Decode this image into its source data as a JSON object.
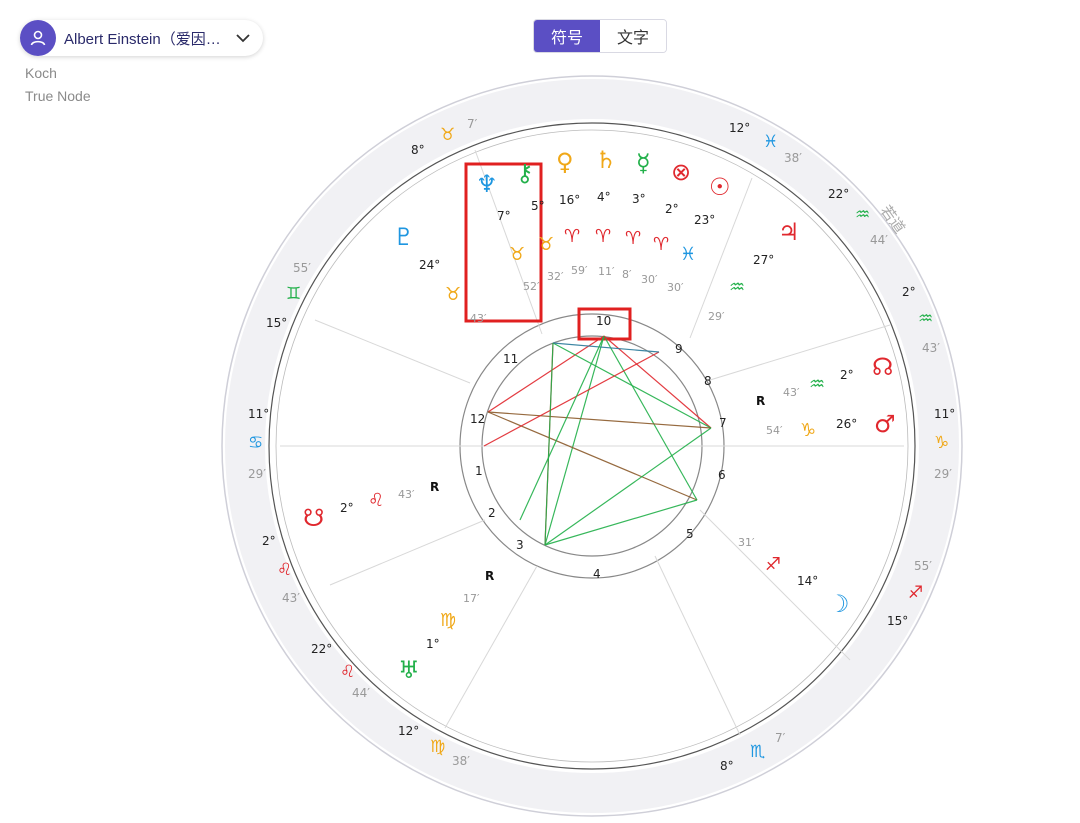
{
  "person": {
    "name": "Albert Einstein（爱因…",
    "avatar_icon": "user-icon",
    "chevron_icon": "chevron-down-icon"
  },
  "house_system": "Koch",
  "node_type": "True Node",
  "view_toggle": {
    "symbol_label": "符号",
    "text_label": "文字",
    "active": "symbol"
  },
  "colors": {
    "accent": "#5b4fc4",
    "fire": "#e0282e",
    "earth": "#f0a818",
    "air": "#22b04a",
    "water": "#1e96e0",
    "highlight": "#e02020"
  },
  "outer_wheel_label": "若道",
  "house_cusps": [
    {
      "id": "asc-left",
      "deg": "11°",
      "sign": "♋",
      "color": "#1e96e0",
      "min": "29′"
    },
    {
      "id": "h2",
      "deg": "2°",
      "sign": "♌",
      "color": "#e0282e",
      "min": "43′"
    },
    {
      "id": "h3",
      "deg": "22°",
      "sign": "♌",
      "color": "#e0282e",
      "min": "44′"
    },
    {
      "id": "h4",
      "deg": "12°",
      "sign": "♍",
      "color": "#f0a818",
      "min": "38′"
    },
    {
      "id": "h5",
      "deg": "8°",
      "sign": "♏",
      "color": "#1e96e0",
      "min": "7′"
    },
    {
      "id": "h6",
      "deg": "15°",
      "sign": "♐",
      "color": "#e0282e",
      "min": "55′"
    },
    {
      "id": "dsc",
      "deg": "11°",
      "sign": "♑",
      "color": "#f0a818",
      "min": "29′"
    },
    {
      "id": "h8",
      "deg": "2°",
      "sign": "♒",
      "color": "#22b04a",
      "min": "43′"
    },
    {
      "id": "h9",
      "deg": "22°",
      "sign": "♒",
      "color": "#22b04a",
      "min": "44′"
    },
    {
      "id": "mc",
      "deg": "12°",
      "sign": "♓",
      "color": "#1e96e0",
      "min": "38′"
    },
    {
      "id": "h11",
      "deg": "8°",
      "sign": "♉",
      "color": "#f0a818",
      "min": "7′"
    },
    {
      "id": "h12",
      "deg": "15°",
      "sign": "♊",
      "color": "#22b04a",
      "min": "55′"
    }
  ],
  "planets": [
    {
      "name": "neptune",
      "glyph": "♆",
      "color": "#1e96e0",
      "deg": "7°",
      "sign": "♉",
      "sign_color": "#f0a818",
      "min": "52′",
      "retro": ""
    },
    {
      "name": "chiron",
      "glyph": "⚷",
      "color": "#22b04a",
      "deg": "5°",
      "sign": "♉",
      "sign_color": "#f0a818",
      "min": "32′",
      "retro": ""
    },
    {
      "name": "venus",
      "glyph": "♀",
      "color": "#f0a818",
      "deg": "16°",
      "sign": "♈",
      "sign_color": "#e0282e",
      "min": "59′",
      "retro": ""
    },
    {
      "name": "saturn",
      "glyph": "♄",
      "color": "#f0a818",
      "deg": "4°",
      "sign": "♈",
      "sign_color": "#e0282e",
      "min": "11′",
      "retro": ""
    },
    {
      "name": "mercury",
      "glyph": "☿",
      "color": "#22b04a",
      "deg": "3°",
      "sign": "♈",
      "sign_color": "#e0282e",
      "min": "8′",
      "retro": ""
    },
    {
      "name": "part-of-fortune",
      "glyph": "⊗",
      "color": "#e0282e",
      "deg": "2°",
      "sign": "♈",
      "sign_color": "#e0282e",
      "min": "30′",
      "retro": ""
    },
    {
      "name": "sun",
      "glyph": "☉",
      "color": "#e0282e",
      "deg": "23°",
      "sign": "♓",
      "sign_color": "#1e96e0",
      "min": "30′",
      "retro": ""
    },
    {
      "name": "jupiter",
      "glyph": "♃",
      "color": "#e0282e",
      "deg": "27°",
      "sign": "♒",
      "sign_color": "#22b04a",
      "min": "29′",
      "retro": ""
    },
    {
      "name": "north-node",
      "glyph": "☊",
      "color": "#e0282e",
      "deg": "2°",
      "sign": "♒",
      "sign_color": "#22b04a",
      "min": "43′",
      "retro": "R"
    },
    {
      "name": "mars",
      "glyph": "♂",
      "color": "#e0282e",
      "deg": "26°",
      "sign": "♑",
      "sign_color": "#f0a818",
      "min": "54′",
      "retro": ""
    },
    {
      "name": "moon",
      "glyph": "☽",
      "color": "#1e96e0",
      "deg": "14°",
      "sign": "♐",
      "sign_color": "#e0282e",
      "min": "31′",
      "retro": ""
    },
    {
      "name": "uranus",
      "glyph": "♅",
      "color": "#22b04a",
      "deg": "1°",
      "sign": "♍",
      "sign_color": "#f0a818",
      "min": "17′",
      "retro": "R"
    },
    {
      "name": "south-node",
      "glyph": "☋",
      "color": "#e0282e",
      "deg": "2°",
      "sign": "♌",
      "sign_color": "#e0282e",
      "min": "43′",
      "retro": "R"
    },
    {
      "name": "pluto",
      "glyph": "♇",
      "color": "#1e96e0",
      "deg": "24°",
      "sign": "♉",
      "sign_color": "#f0a818",
      "min": "43′",
      "retro": ""
    }
  ],
  "house_numbers": [
    "1",
    "2",
    "3",
    "4",
    "5",
    "6",
    "7",
    "8",
    "9",
    "10",
    "11",
    "12"
  ],
  "aspects": [
    {
      "from": "mc",
      "to": "h12",
      "color": "#e0282e",
      "symbol": ""
    },
    {
      "from": "mc",
      "to": "h3",
      "color": "#22b04a",
      "symbol": ""
    },
    {
      "from": "mc",
      "to": "h5",
      "color": "#22b04a",
      "symbol": ""
    },
    {
      "from": "mc",
      "to": "dsc",
      "color": "#e0282e",
      "symbol": ""
    },
    {
      "from": "h11",
      "to": "h3",
      "color": "#e0282e",
      "symbol": ""
    },
    {
      "from": "h11",
      "to": "dsc",
      "color": "#22b04a",
      "symbol": ""
    },
    {
      "from": "h12",
      "to": "h5",
      "color": "#8b5a2b",
      "symbol": ""
    },
    {
      "from": "h12",
      "to": "dsc",
      "color": "#8b5a2b",
      "symbol": ""
    },
    {
      "from": "h3",
      "to": "h5",
      "color": "#22b04a",
      "symbol": ""
    },
    {
      "from": "h3",
      "to": "dsc",
      "color": "#22b04a",
      "symbol": ""
    },
    {
      "from": "asc",
      "to": "h9",
      "color": "#e0282e",
      "symbol": ""
    },
    {
      "from": "h11",
      "to": "h9",
      "color": "#2a7a9a",
      "symbol": ""
    },
    {
      "from": "h2",
      "to": "mc",
      "color": "#22b04a",
      "symbol": ""
    },
    {
      "from": "h3",
      "to": "h11",
      "color": "#22b04a",
      "symbol": ""
    }
  ]
}
